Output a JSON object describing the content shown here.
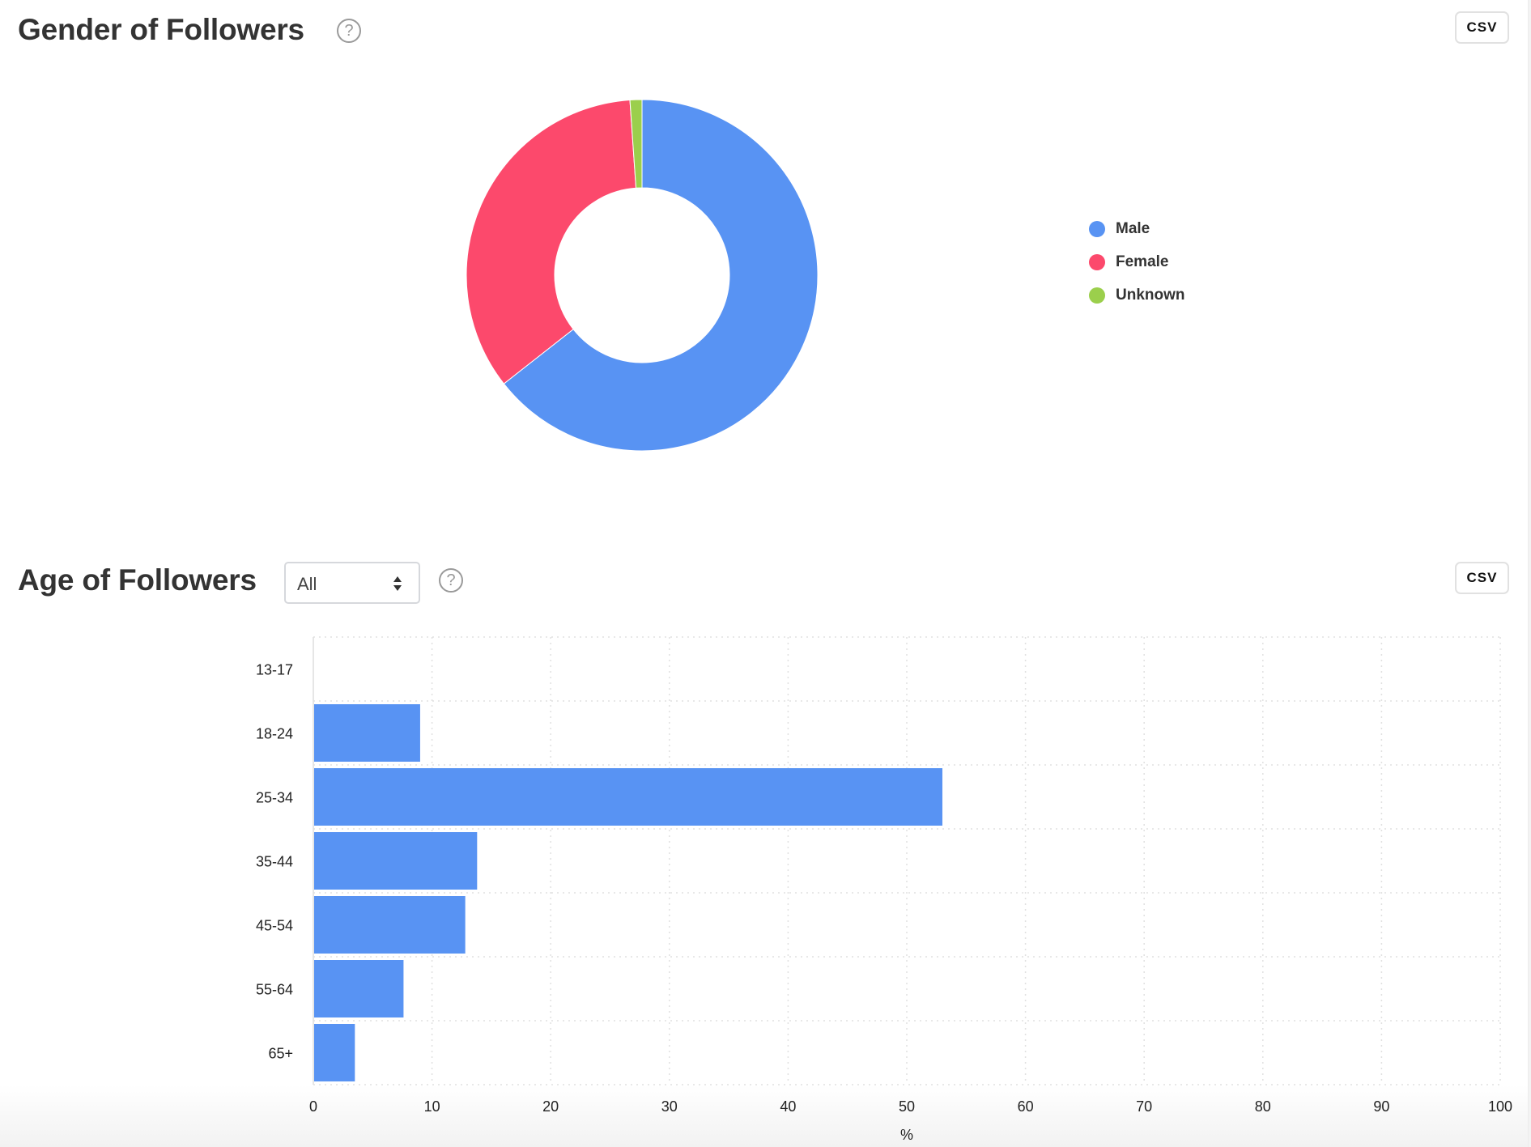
{
  "gender_section": {
    "title": "Gender of Followers",
    "help_icon": "question-circle-icon",
    "csv_label": "CSV"
  },
  "age_section": {
    "title": "Age of Followers",
    "filter": {
      "selected": "All",
      "icon": "select-updown-arrows-icon"
    },
    "help_icon": "question-circle-icon",
    "csv_label": "CSV"
  },
  "colors": {
    "male": "#5893f3",
    "female": "#fc496c",
    "unknown": "#9bcf4c",
    "bar": "#5893f3"
  },
  "chart_data": [
    {
      "type": "pie",
      "variant": "donut",
      "title": "Gender of Followers",
      "legend_position": "right",
      "categories": [
        "Male",
        "Female",
        "Unknown"
      ],
      "values": [
        64.4,
        34.5,
        1.1
      ],
      "unit": "%"
    },
    {
      "type": "bar",
      "orientation": "horizontal",
      "title": "Age of Followers",
      "categories": [
        "13-17",
        "18-24",
        "25-34",
        "35-44",
        "45-54",
        "55-64",
        "65+"
      ],
      "values": [
        0,
        9.0,
        53.0,
        13.8,
        12.8,
        7.6,
        3.5
      ],
      "xlabel": "%",
      "ylabel": "",
      "xlim": [
        0,
        100
      ],
      "xticks": [
        "0",
        "10",
        "20",
        "30",
        "40",
        "50",
        "60",
        "70",
        "80",
        "90",
        "100"
      ],
      "grid": true
    }
  ]
}
